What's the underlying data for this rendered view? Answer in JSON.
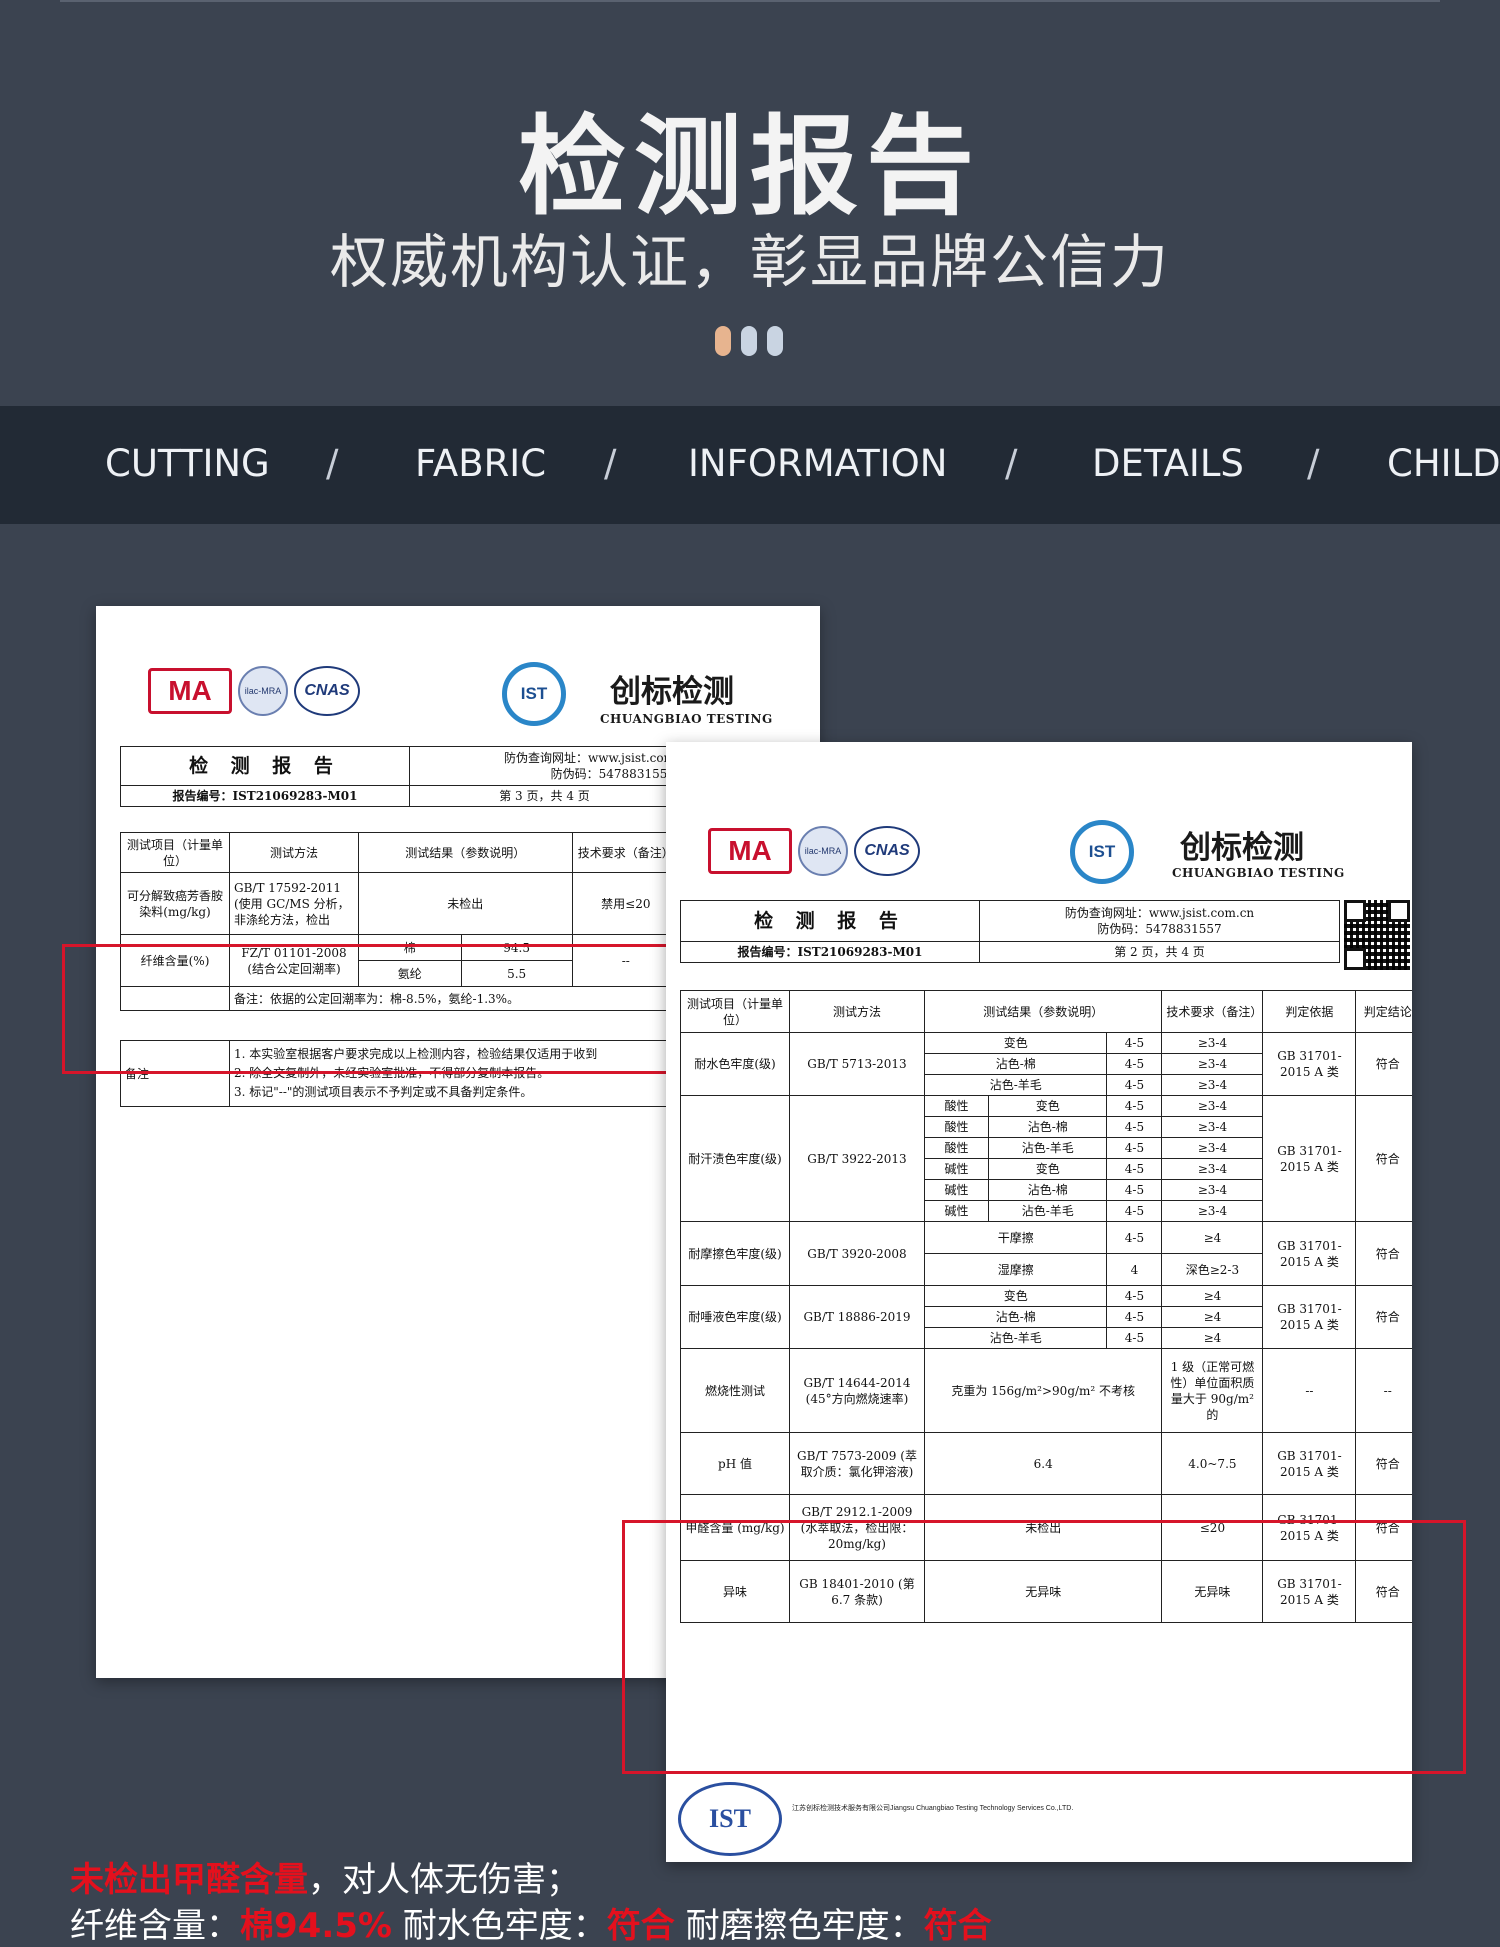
{
  "hero": {
    "title": "检测报告",
    "subtitle": "权威机构认证，彰显品牌公信力"
  },
  "pager": {
    "count": 3,
    "active_index": 0
  },
  "nav": {
    "items": [
      "CUTTING",
      "FABRIC",
      "INFORMATION",
      "DETAILS",
      "CHILDR"
    ],
    "separator": "/"
  },
  "logos": {
    "ma": "MA",
    "ilac": "ilac-MRA",
    "cnas": "CNAS",
    "ist": "IST",
    "brand_cn": "创标检测",
    "brand_en": "CHUANGBIAO TESTING"
  },
  "report1": {
    "title": "检 测 报 告",
    "verify_url": "防伪查询网址：www.jsist.com",
    "verify_code": "防伪码：5478831557",
    "report_no": "报告编号：IST21069283-M01",
    "page": "第 3 页，共 4 页",
    "headers": [
      "测试项目（计量单位）",
      "测试方法",
      "测试结果（参数说明）",
      "技术要求（备注）"
    ],
    "row_azo": {
      "item": "可分解致癌芳香胺染料(mg/kg)",
      "method": "GB/T 17592-2011 (使用 GC/MS 分析，非涤纶方法，检出",
      "result": "未检出",
      "req": "禁用≤20"
    },
    "row_fiber": {
      "item": "纤维含量(%)",
      "method": "FZ/T 01101-2008 (结合公定回潮率)",
      "mat1": "棉",
      "val1": "94.5",
      "mat2": "氨纶",
      "val2": "5.5",
      "req": "--",
      "note": "备注：依据的公定回潮率为：棉-8.5%，氨纶-1.3%。"
    },
    "remarks_label": "备注",
    "remarks": [
      "1.  本实验室根据客户要求完成以上检测内容，检验结果仅适用于收到",
      "2.  除全文复制外，未经实验室批准，不得部分复制本报告。",
      "3.  标记\"--\"的测试项目表示不予判定或不具备判定条件。"
    ]
  },
  "report2": {
    "title": "检 测 报 告",
    "verify_url": "防伪查询网址：www.jsist.com.cn",
    "verify_code": "防伪码：5478831557",
    "report_no": "报告编号：IST21069283-M01",
    "page": "第 2 页，共 4 页",
    "headers": [
      "测试项目（计量单位）",
      "测试方法",
      "测试结果（参数说明）",
      "技术要求（备注）",
      "判定依据",
      "判定结论"
    ],
    "basis": "GB 31701-2015 A 类",
    "pass": "符合",
    "water": {
      "item": "耐水色牢度(级)",
      "method": "GB/T 5713-2013",
      "rows": [
        [
          "变色",
          "4-5",
          "≥3-4"
        ],
        [
          "沾色-棉",
          "4-5",
          "≥3-4"
        ],
        [
          "沾色-羊毛",
          "4-5",
          "≥3-4"
        ]
      ]
    },
    "sweat": {
      "item": "耐汗渍色牢度(级)",
      "method": "GB/T 3922-2013",
      "rows": [
        [
          "酸性",
          "变色",
          "4-5",
          "≥3-4"
        ],
        [
          "酸性",
          "沾色-棉",
          "4-5",
          "≥3-4"
        ],
        [
          "酸性",
          "沾色-羊毛",
          "4-5",
          "≥3-4"
        ],
        [
          "碱性",
          "变色",
          "4-5",
          "≥3-4"
        ],
        [
          "碱性",
          "沾色-棉",
          "4-5",
          "≥3-4"
        ],
        [
          "碱性",
          "沾色-羊毛",
          "4-5",
          "≥3-4"
        ]
      ]
    },
    "rub": {
      "item": "耐摩擦色牢度(级)",
      "method": "GB/T 3920-2008",
      "rows": [
        [
          "干摩擦",
          "4-5",
          "≥4"
        ],
        [
          "湿摩擦",
          "4",
          "深色≥2-3"
        ]
      ]
    },
    "saliva": {
      "item": "耐唾液色牢度(级)",
      "method": "GB/T 18886-2019",
      "rows": [
        [
          "变色",
          "4-5",
          "≥4"
        ],
        [
          "沾色-棉",
          "4-5",
          "≥4"
        ],
        [
          "沾色-羊毛",
          "4-5",
          "≥4"
        ]
      ]
    },
    "burn": {
      "item": "燃烧性测试",
      "method": "GB/T 14644-2014 (45°方向燃烧速率)",
      "result": "克重为 156g/m²>90g/m² 不考核",
      "req": "1 级（正常可燃性）单位面积质量大于 90g/m² 的",
      "basis": "--",
      "conclusion": "--"
    },
    "ph": {
      "item": "pH 值",
      "method": "GB/T 7573-2009 (萃取介质：氯化钾溶液)",
      "result": "6.4",
      "req": "4.0~7.5"
    },
    "formaldehyde": {
      "item": "甲醛含量 (mg/kg)",
      "method": "GB/T 2912.1-2009 (水萃取法，检出限：20mg/kg)",
      "result": "未检出",
      "req": "≤20"
    },
    "odor": {
      "item": "异味",
      "method": "GB 18401-2010 (第 6.7 条款)",
      "result": "无异味",
      "req": "无异味"
    },
    "footer_company": "江苏创标检测技术服务有限公司Jiangsu Chuangbiao Testing Technology Services Co.,LTD."
  },
  "bottom": {
    "l1_red": "未检出甲醛含量",
    "l1_white": "，对人体无伤害；",
    "l2_a": "纤维含量：",
    "l2_b": "棉94.5%",
    "l2_c": " 耐水色牢度：",
    "l2_d": "符合",
    "l2_e": " 耐磨擦色牢度：",
    "l2_f": "符合"
  },
  "colors": {
    "background": "#3b4350",
    "navbar": "#222a35",
    "highlight": "#d6152a",
    "accent_dot": "#e7b48f"
  }
}
